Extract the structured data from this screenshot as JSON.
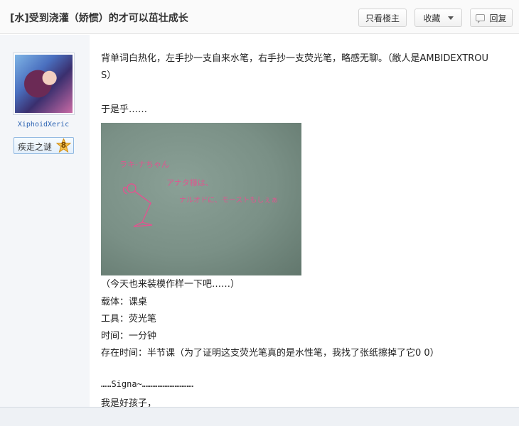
{
  "header": {
    "thread_title": "[水]受到浇灌（娇惯）的才可以茁壮成长",
    "only_louzhu_label": "只看楼主",
    "favorite_label": "收藏",
    "reply_label": "回复"
  },
  "author": {
    "username": "XiphoidXeric",
    "level_title": "疾走之谜",
    "level_number": "8"
  },
  "post": {
    "line1": "背单词白热化，左手抄一支自来水笔，右手抄一支荧光笔，略感无聊。（敝人是AMBIDEXTROU",
    "line1b": "S）",
    "line2": "于是乎……",
    "photo_text": {
      "t1": "ラキ-ナちゃん",
      "t2": "アナタ様は、",
      "t3": "ナルオドに、モーストもしぇぁ"
    },
    "caption": "（今天也来装模作样一下吧……）",
    "carrier": "载体：课桌",
    "tool": "工具：荧光笔",
    "time": "时间：一分钟",
    "duration": "存在时间：半节课（为了证明这支荧光笔真的是水性笔，我找了张纸擦掉了它0 0）",
    "signature_line": "……Signa~…………………………",
    "last_line": "我是好孩子，"
  }
}
